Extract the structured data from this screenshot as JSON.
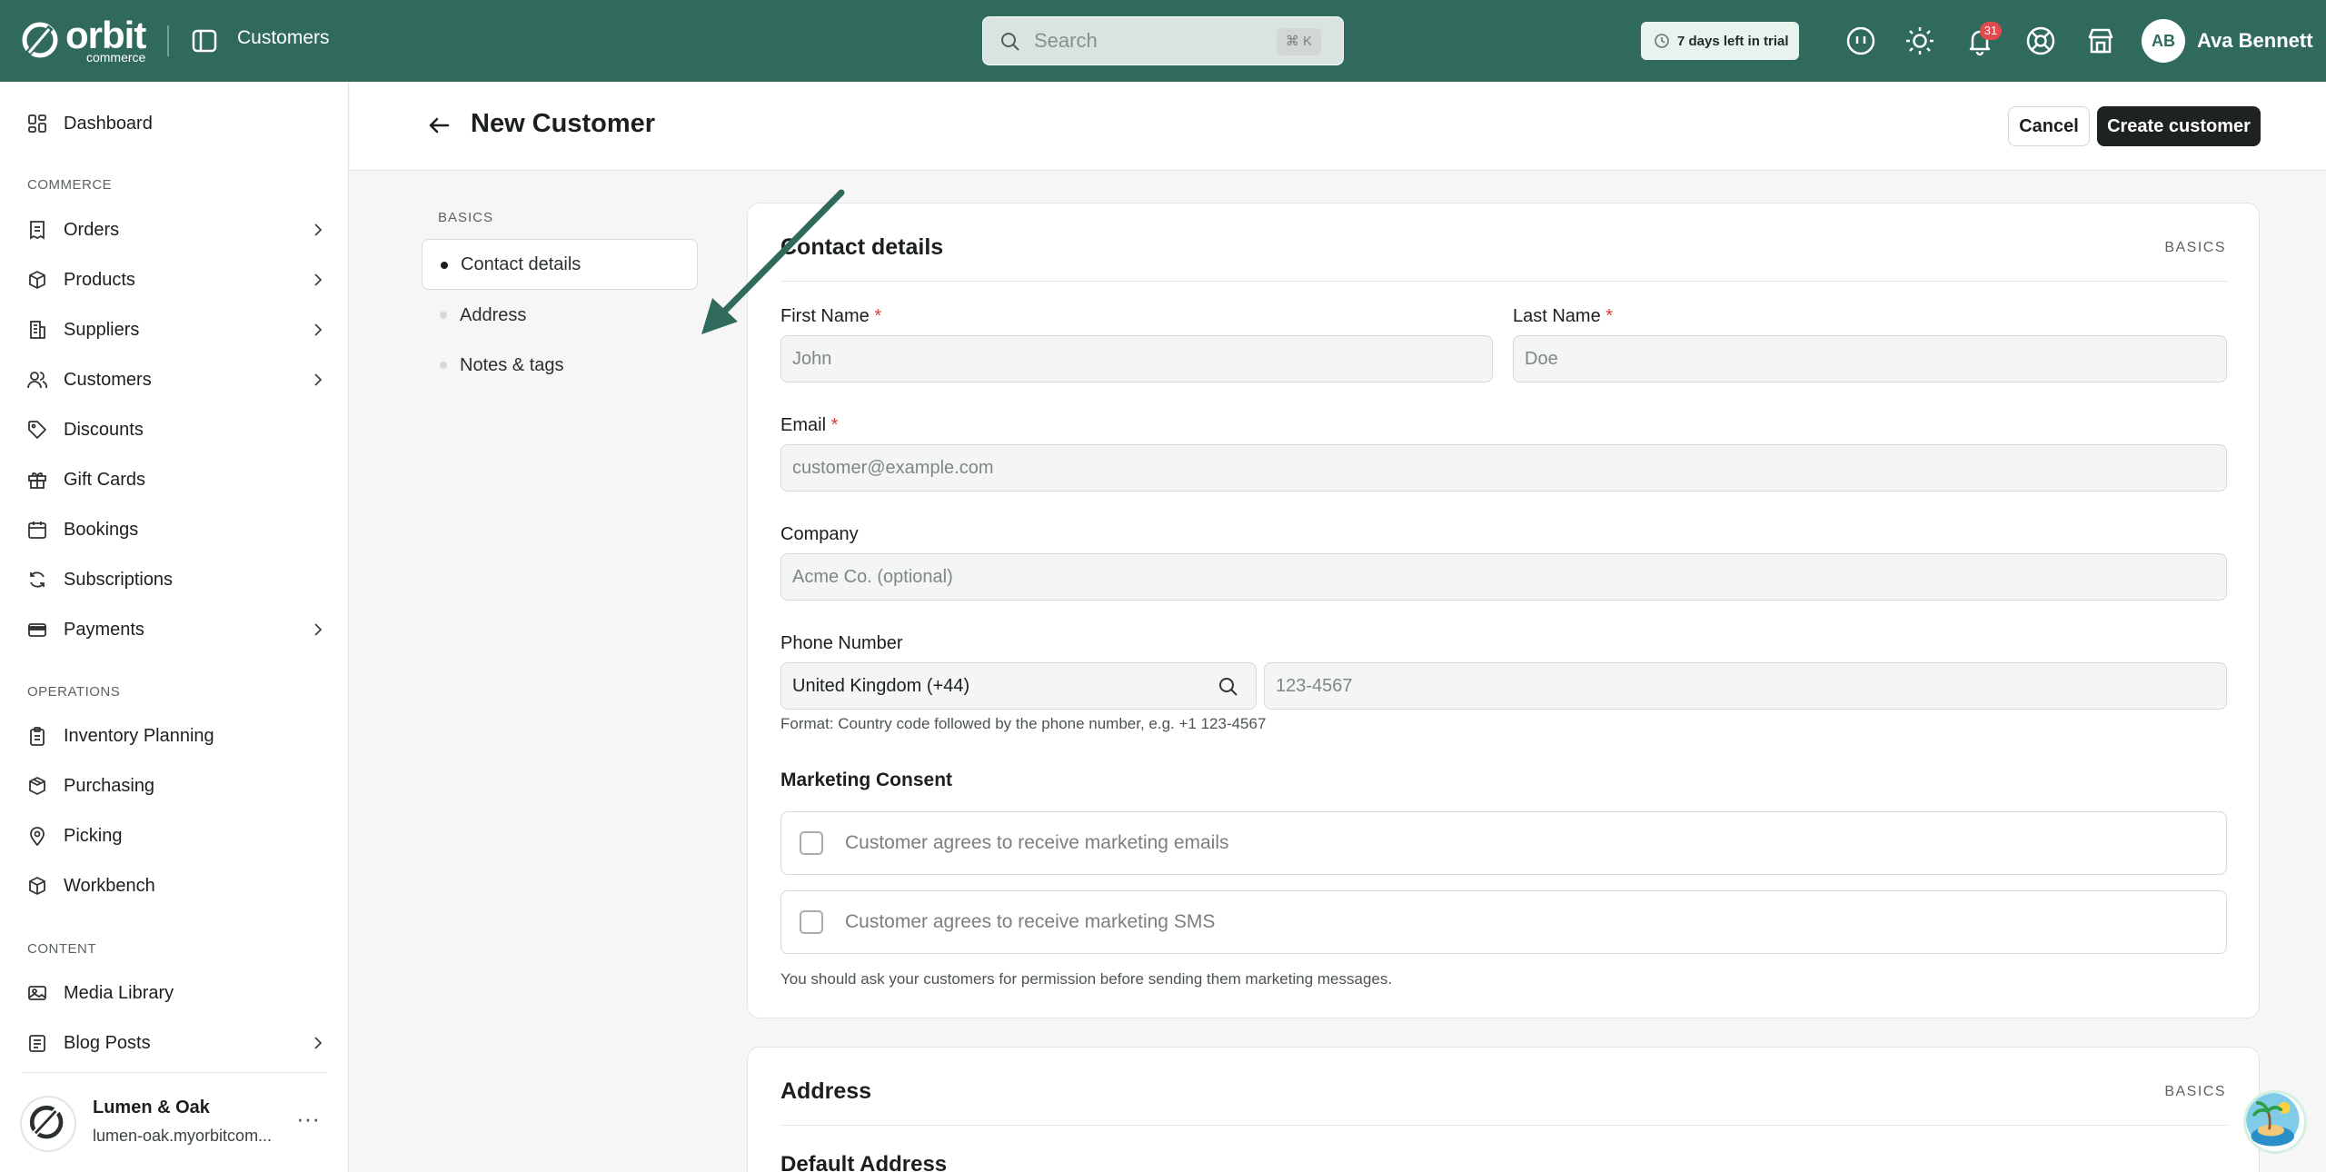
{
  "topbar": {
    "logo_word": "orbit",
    "logo_sub": "commerce",
    "breadcrumb": "Customers",
    "search_placeholder": "Search",
    "search_shortcut": "⌘ K",
    "trial_text": "7 days left in trial",
    "notification_count": "31",
    "avatar_initials": "AB",
    "user_name": "Ava Bennett",
    "icons": [
      "sidebar-toggle-icon",
      "search-icon",
      "clock-icon",
      "assistant-icon",
      "sun-icon",
      "bell-icon",
      "help-icon",
      "store-icon"
    ]
  },
  "sidebar": {
    "dashboard": "Dashboard",
    "sections": {
      "commerce": "COMMERCE",
      "operations": "OPERATIONS",
      "content": "CONTENT"
    },
    "items": {
      "orders": "Orders",
      "products": "Products",
      "suppliers": "Suppliers",
      "customers": "Customers",
      "discounts": "Discounts",
      "gift_cards": "Gift Cards",
      "bookings": "Bookings",
      "subscriptions": "Subscriptions",
      "payments": "Payments",
      "inventory_planning": "Inventory Planning",
      "purchasing": "Purchasing",
      "picking": "Picking",
      "workbench": "Workbench",
      "media_library": "Media Library",
      "blog_posts": "Blog Posts"
    },
    "store": {
      "name": "Lumen & Oak",
      "url": "lumen-oak.myorbitcom...",
      "more": "···"
    }
  },
  "header": {
    "title": "New Customer",
    "cancel_label": "Cancel",
    "create_label": "Create customer"
  },
  "section_nav": {
    "label": "BASICS",
    "items": [
      "Contact details",
      "Address",
      "Notes & tags"
    ]
  },
  "contact": {
    "title": "Contact details",
    "tag": "BASICS",
    "first_name_label": "First Name",
    "first_name_placeholder": "John",
    "last_name_label": "Last Name",
    "last_name_placeholder": "Doe",
    "email_label": "Email",
    "email_placeholder": "customer@example.com",
    "company_label": "Company",
    "company_placeholder": "Acme Co. (optional)",
    "phone_label": "Phone Number",
    "country_value": "United Kingdom (+44)",
    "phone_placeholder": "123-4567",
    "phone_hint": "Format: Country code followed by the phone number, e.g. +1 123-4567",
    "required_mark": "*",
    "marketing_title": "Marketing Consent",
    "consent_email": "Customer agrees to receive marketing emails",
    "consent_sms": "Customer agrees to receive marketing SMS",
    "consent_hint": "You should ask your customers for permission before sending them marketing messages."
  },
  "address": {
    "title": "Address",
    "tag": "BASICS",
    "default_address": "Default Address"
  },
  "colors": {
    "brand": "#2f6a5c",
    "annotation_arrow": "#2f6a5c",
    "required": "#d83c3c",
    "badge": "#e5484d"
  }
}
